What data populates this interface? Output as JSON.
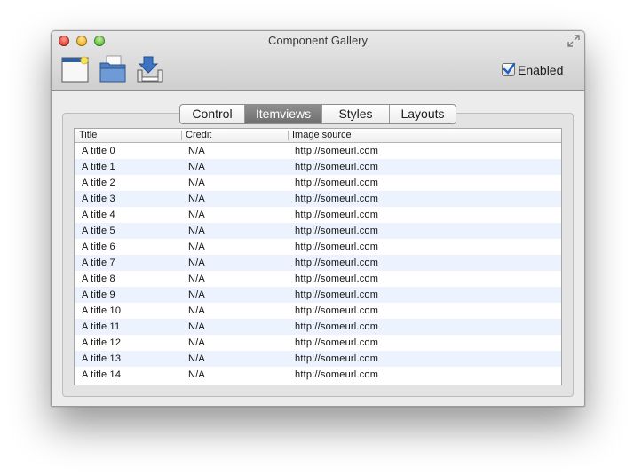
{
  "window": {
    "title": "Component Gallery"
  },
  "toolbar": {
    "buttons": [
      {
        "icon": "window-icon"
      },
      {
        "icon": "folder-icon"
      },
      {
        "icon": "download-icon"
      }
    ],
    "enabled_label": "Enabled",
    "enabled_checked": true
  },
  "tabs": [
    {
      "label": "Control",
      "active": false
    },
    {
      "label": "Itemviews",
      "active": true
    },
    {
      "label": "Styles",
      "active": false
    },
    {
      "label": "Layouts",
      "active": false
    }
  ],
  "table": {
    "columns": [
      "Title",
      "Credit",
      "Image source"
    ],
    "rows": [
      [
        "A title 0",
        "N/A",
        "http://someurl.com"
      ],
      [
        "A title 1",
        "N/A",
        "http://someurl.com"
      ],
      [
        "A title 2",
        "N/A",
        "http://someurl.com"
      ],
      [
        "A title 3",
        "N/A",
        "http://someurl.com"
      ],
      [
        "A title 4",
        "N/A",
        "http://someurl.com"
      ],
      [
        "A title 5",
        "N/A",
        "http://someurl.com"
      ],
      [
        "A title 6",
        "N/A",
        "http://someurl.com"
      ],
      [
        "A title 7",
        "N/A",
        "http://someurl.com"
      ],
      [
        "A title 8",
        "N/A",
        "http://someurl.com"
      ],
      [
        "A title 9",
        "N/A",
        "http://someurl.com"
      ],
      [
        "A title 10",
        "N/A",
        "http://someurl.com"
      ],
      [
        "A title 11",
        "N/A",
        "http://someurl.com"
      ],
      [
        "A title 12",
        "N/A",
        "http://someurl.com"
      ],
      [
        "A title 13",
        "N/A",
        "http://someurl.com"
      ],
      [
        "A title 14",
        "N/A",
        "http://someurl.com"
      ]
    ]
  },
  "colors": {
    "alt_row": "#edf3fe",
    "active_tab": "#7a7a7a",
    "checkbox_check": "#1d5fc4"
  }
}
